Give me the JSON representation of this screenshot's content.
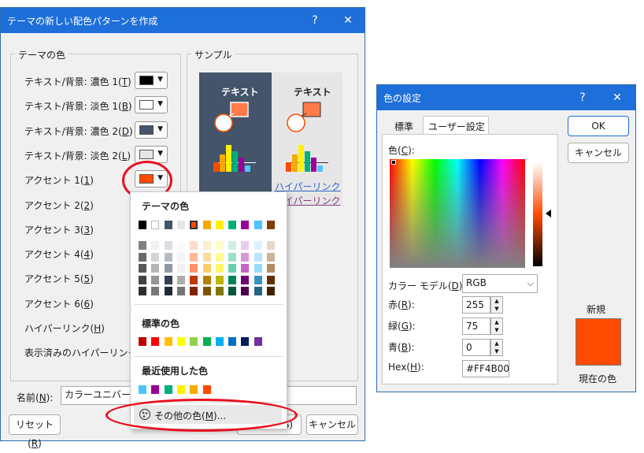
{
  "theme_dialog": {
    "title": "テーマの新しい配色パターンを作成",
    "help": "?",
    "close": "✕",
    "group_theme_colors": "テーマの色",
    "group_sample": "サンプル",
    "rows": [
      {
        "label": "テキスト/背景: 濃色 1(",
        "key": "T",
        "end": ")",
        "color": "#000000"
      },
      {
        "label": "テキスト/背景: 淡色 1(",
        "key": "B",
        "end": ")",
        "color": "#ffffff"
      },
      {
        "label": "テキスト/背景: 濃色 2(",
        "key": "D",
        "end": ")",
        "color": "#44546a"
      },
      {
        "label": "テキスト/背景: 淡色 2(",
        "key": "L",
        "end": ")",
        "color": "#e7e6e6"
      },
      {
        "label": "アクセント 1(",
        "key": "1",
        "end": ")",
        "color": "#ff4b00"
      },
      {
        "label": "アクセント 2(",
        "key": "2",
        "end": ")"
      },
      {
        "label": "アクセント 3(",
        "key": "3",
        "end": ")"
      },
      {
        "label": "アクセント 4(",
        "key": "4",
        "end": ")"
      },
      {
        "label": "アクセント 5(",
        "key": "5",
        "end": ")"
      },
      {
        "label": "アクセント 6(",
        "key": "6",
        "end": ")"
      },
      {
        "label": "ハイパーリンク(",
        "key": "H",
        "end": ")"
      },
      {
        "label": "表示済みのハイパーリンク(",
        "key": "F",
        "end": ")"
      }
    ],
    "sample_text": "テキスト",
    "sample_link": "ハイパーリンク",
    "name_label": "名前(",
    "name_key": "N",
    "name_end": "):",
    "name_value": "カラーユニバーサルデザ",
    "reset_label": "リセット(",
    "reset_key": "R",
    "reset_end": ")",
    "save_partial": "(S)",
    "cancel_label": "キャンセル"
  },
  "palette": {
    "theme_heading": "テーマの色",
    "theme_top": [
      "#000000",
      "#ffffff",
      "#44546a",
      "#e7e6e6",
      "#ff4b00",
      "#f6aa00",
      "#fff100",
      "#03af7a",
      "#990099",
      "#4dc4ff",
      "#804000"
    ],
    "standard_heading": "標準の色",
    "standard": [
      "#c00000",
      "#ff0000",
      "#ffc000",
      "#ffff00",
      "#92d050",
      "#00b050",
      "#00b0f0",
      "#0070c0",
      "#002060",
      "#7030a0"
    ],
    "recent_heading": "最近使用した色",
    "recent": [
      "#4dc4ff",
      "#990099",
      "#03af7a",
      "#fff100",
      "#f6aa00",
      "#ff4b00"
    ],
    "more_colors": "その他の色(",
    "more_key": "M",
    "more_end": ")..."
  },
  "color_dialog": {
    "title": "色の設定",
    "help": "?",
    "close": "✕",
    "tab_standard": "標準",
    "tab_custom": "ユーザー設定",
    "ok": "OK",
    "cancel": "キャンセル",
    "colors_label": "色(",
    "colors_key": "C",
    "colors_end": "):",
    "model_label": "カラー モデル(",
    "model_key": "D",
    "model_end": "):",
    "model_value": "RGB",
    "red_label": "赤(",
    "red_key": "R",
    "green_label": "緑(",
    "green_key": "G",
    "blue_label": "青(",
    "blue_key": "B",
    "hex_label": "Hex(",
    "hex_key": "H",
    "close_paren": "):",
    "red_value": "255",
    "green_value": "75",
    "blue_value": "0",
    "hex_value": "#FF4B00",
    "new_label": "新規",
    "current_label": "現在の色",
    "current_color": "#ff4b00"
  }
}
